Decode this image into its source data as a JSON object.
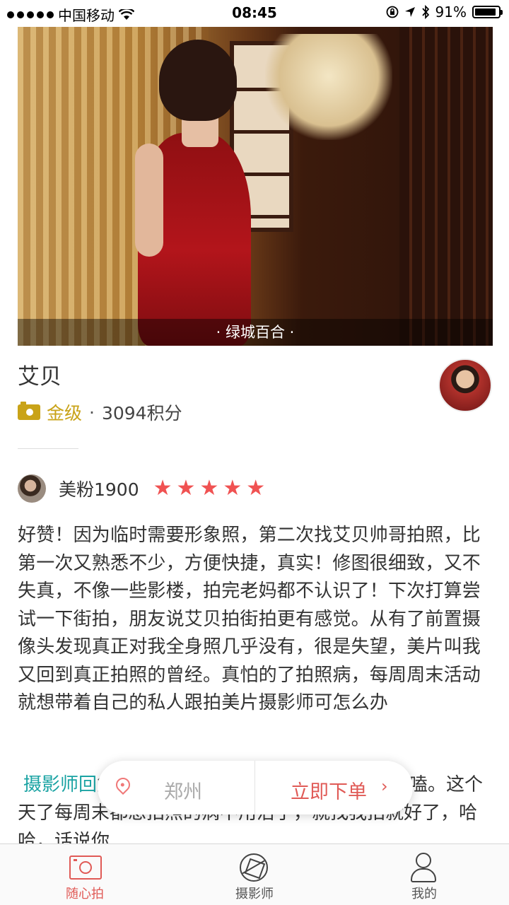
{
  "status_bar": {
    "carrier": "中国移动",
    "time": "08:45",
    "battery": "91%",
    "battery_level": 0.91
  },
  "hero": {
    "caption": "· 绿城百合 ·"
  },
  "photographer": {
    "name": "艾贝",
    "level": "金级",
    "separator": "·",
    "points": "3094积分"
  },
  "review": {
    "reviewer": "美粉1900",
    "rating": 5,
    "star_glyph": "★",
    "text": "好赞！因为临时需要形象照，第二次找艾贝帅哥拍照，比第一次又熟悉不少，方便快捷，真实！修图很细致，又不失真，不像一些影楼，拍完老妈都不认识了！下次打算尝试一下街拍，朋友说艾贝拍街拍更有感觉。从有了前置摄像头发现真正对我全身照几乎没有，很是失望，美片叫我又回到真正拍照的曾经。真怕的了拍照病，每周周末活动就想带着自己的私人跟拍美片摄影师可怎么办"
  },
  "reply": {
    "label": "摄影师回",
    "text": "复：……成。爽爽哒！又能美，又能吻嗑。这个天了每周末都想拍照的病不用治了，就找我拍就好了，哈哈，话说你"
  },
  "action_pill": {
    "city": "郑州",
    "order_label": "立即下单",
    "chevron": "›"
  },
  "tabs": [
    {
      "label": "随心拍",
      "icon": "camera-icon",
      "active": true
    },
    {
      "label": "摄影师",
      "icon": "aperture-icon",
      "active": false
    },
    {
      "label": "我的",
      "icon": "user-icon",
      "active": false
    }
  ],
  "colors": {
    "accent": "#e05a56",
    "gold": "#c9a318",
    "teal": "#1aa3a3",
    "star": "#f05252"
  }
}
